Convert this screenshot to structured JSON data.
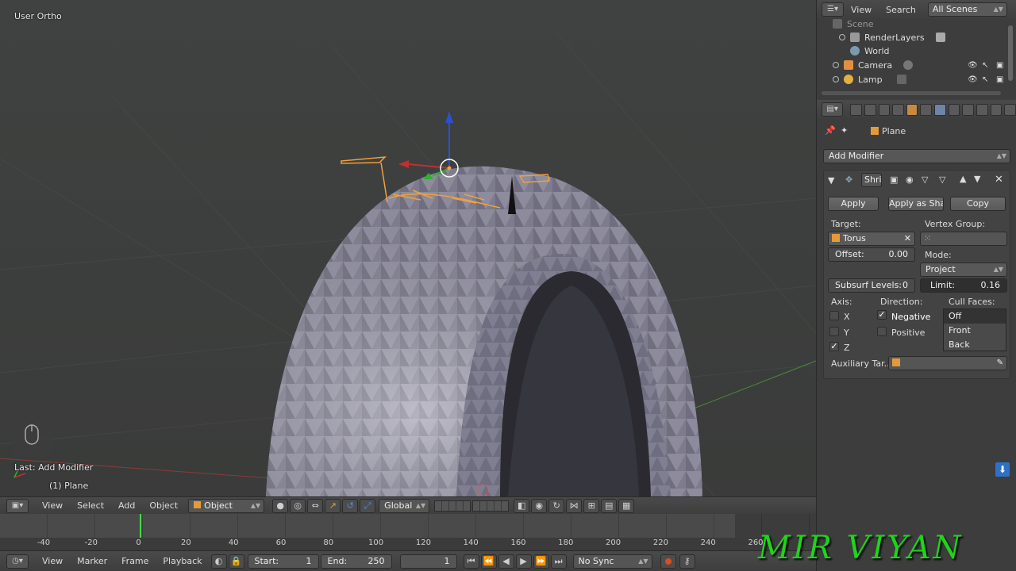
{
  "viewport": {
    "view_name": "User Ortho",
    "last_operation": "Last: Add Modifier",
    "active_object": "(1) Plane"
  },
  "viewport_header": {
    "menus": [
      "View",
      "Select",
      "Add",
      "Object"
    ],
    "mode": "Object Mode",
    "orientation": "Global"
  },
  "timeline": {
    "ticks": [
      "-40",
      "-20",
      "0",
      "20",
      "40",
      "60",
      "80",
      "100",
      "120",
      "140",
      "160",
      "180",
      "200",
      "220",
      "240",
      "260"
    ],
    "menus": [
      "View",
      "Marker",
      "Frame",
      "Playback"
    ],
    "start_label": "Start:",
    "start_value": "1",
    "end_label": "End:",
    "end_value": "250",
    "current_frame": "1",
    "sync": "No Sync"
  },
  "outliner": {
    "menus": [
      "View",
      "Search"
    ],
    "scene_filter": "All Scenes",
    "items": [
      {
        "label": "Scene",
        "icon": "scene-icon"
      },
      {
        "label": "RenderLayers",
        "icon": "render-layers-icon"
      },
      {
        "label": "World",
        "icon": "world-icon"
      },
      {
        "label": "Camera",
        "icon": "camera-icon"
      },
      {
        "label": "Lamp",
        "icon": "lamp-icon"
      }
    ]
  },
  "properties": {
    "context_object": "Plane",
    "add_modifier": "Add Modifier",
    "modifier_name": "Shri",
    "apply": "Apply",
    "apply_as_shape": "Apply as Sha...",
    "copy": "Copy",
    "target_label": "Target:",
    "target_value": "Torus",
    "vertex_group_label": "Vertex Group:",
    "offset_label": "Offset:",
    "offset_value": "0.00",
    "mode_label": "Mode:",
    "mode_value": "Project",
    "subsurf_label": "Subsurf Levels:",
    "subsurf_value": "0",
    "limit_label": "Limit:",
    "limit_value": "0.16",
    "axis_label": "Axis:",
    "direction_label": "Direction:",
    "cull_label": "Cull Faces:",
    "axis_x": "X",
    "axis_y": "Y",
    "axis_z": "Z",
    "negative": "Negative",
    "positive": "Positive",
    "cull_options": [
      "Off",
      "Front",
      "Back"
    ],
    "aux_target": "Auxiliary Tar..."
  },
  "watermark": "MIR VIYAN",
  "colors": {
    "object_orange": "#e59a3a",
    "timeline_cursor": "#45d84a",
    "watermark_green": "#1fd41a"
  }
}
